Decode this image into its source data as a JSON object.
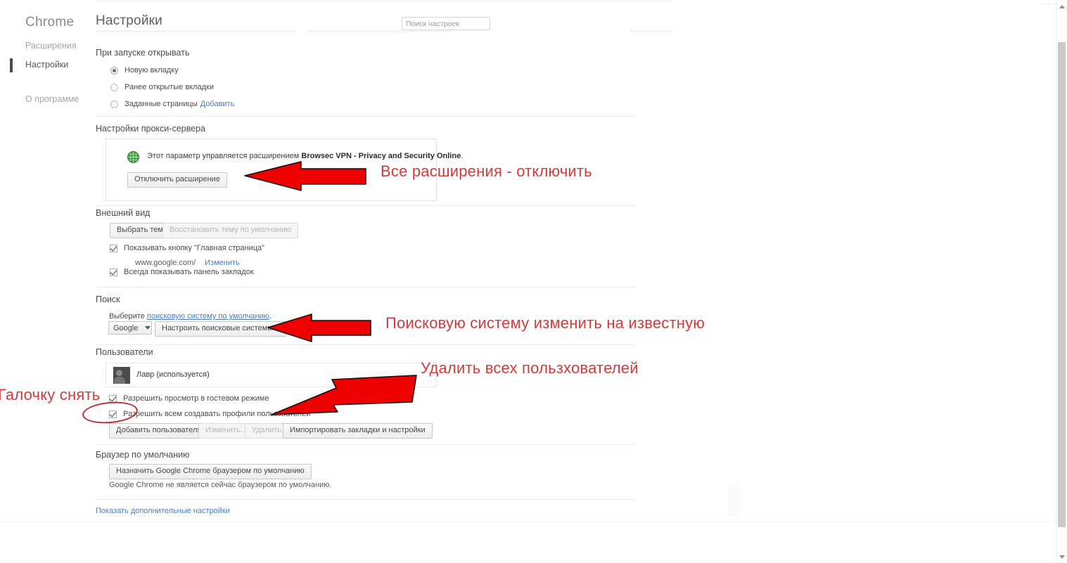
{
  "sidebar": {
    "brand": "Chrome",
    "items": [
      {
        "label": "Расширения",
        "active": false
      },
      {
        "label": "Настройки",
        "active": true
      },
      {
        "label": "О программе",
        "active": false
      }
    ]
  },
  "header": {
    "title": "Настройки",
    "search_placeholder": "Поиск настроек"
  },
  "startup": {
    "title": "При запуске открывать",
    "options": [
      {
        "label": "Новую вкладку",
        "selected": true
      },
      {
        "label": "Ранее открытые вкладки",
        "selected": false
      },
      {
        "label": "Заданные страницы",
        "selected": false,
        "link": "Добавить"
      }
    ]
  },
  "proxy": {
    "title": "Настройки прокси-сервера",
    "managed_prefix": "Этот параметр управляется расширением",
    "extension_name": "Browsec VPN - Privacy and Security Online",
    "managed_suffix": ".",
    "disable_button": "Отключить расширение",
    "icon": "globe-icon"
  },
  "appearance": {
    "title": "Внешний вид",
    "choose_theme_button": "Выбрать тему",
    "reset_theme_button": "Восстановить тему по умолчанию",
    "show_home_button": {
      "label": "Показывать кнопку \"Главная страница\"",
      "checked": true
    },
    "home_url": "www.google.com/",
    "home_change_link": "Изменить",
    "show_bookmarks_bar": {
      "label": "Всегда показывать панель закладок",
      "checked": true
    }
  },
  "search": {
    "title": "Поиск",
    "prefix": "Выберите ",
    "link": "поисковую систему по умолчанию",
    "suffix": ".",
    "engine_selected": "Google",
    "manage_button": "Настроить поисковые системы..."
  },
  "users": {
    "title": "Пользователи",
    "profile_name": "Лавр (используется)",
    "guest_checkbox": {
      "label": "Разрешить просмотр в гостевом режиме",
      "checked": true
    },
    "anyone_checkbox": {
      "label": "Разрешить всем создавать профили пользователей",
      "checked": true
    },
    "buttons": [
      {
        "label": "Добавить пользователя",
        "disabled": false
      },
      {
        "label": "Изменить...",
        "disabled": true
      },
      {
        "label": "Удалить",
        "disabled": true
      },
      {
        "label": "Импортировать закладки и настройки",
        "disabled": false
      }
    ]
  },
  "default_browser": {
    "title": "Браузер по умолчанию",
    "set_default_button": "Назначить Google Chrome браузером по умолчанию",
    "status_text": "Google Chrome не является сейчас браузером по умолчанию."
  },
  "advanced_link": "Показать дополнительные настройки",
  "annotations": {
    "color": "#d23b3b",
    "circle_color": "#b5303a",
    "items": [
      {
        "text": "Все расширения - отключить"
      },
      {
        "text": "Поисковую систему изменить на известную"
      },
      {
        "text": "Удалить всех пользхователей"
      },
      {
        "text": "Галочку снять"
      }
    ]
  },
  "scrollbar": {
    "up_icon": "chevron-up-icon",
    "down_icon": "chevron-down-icon"
  }
}
